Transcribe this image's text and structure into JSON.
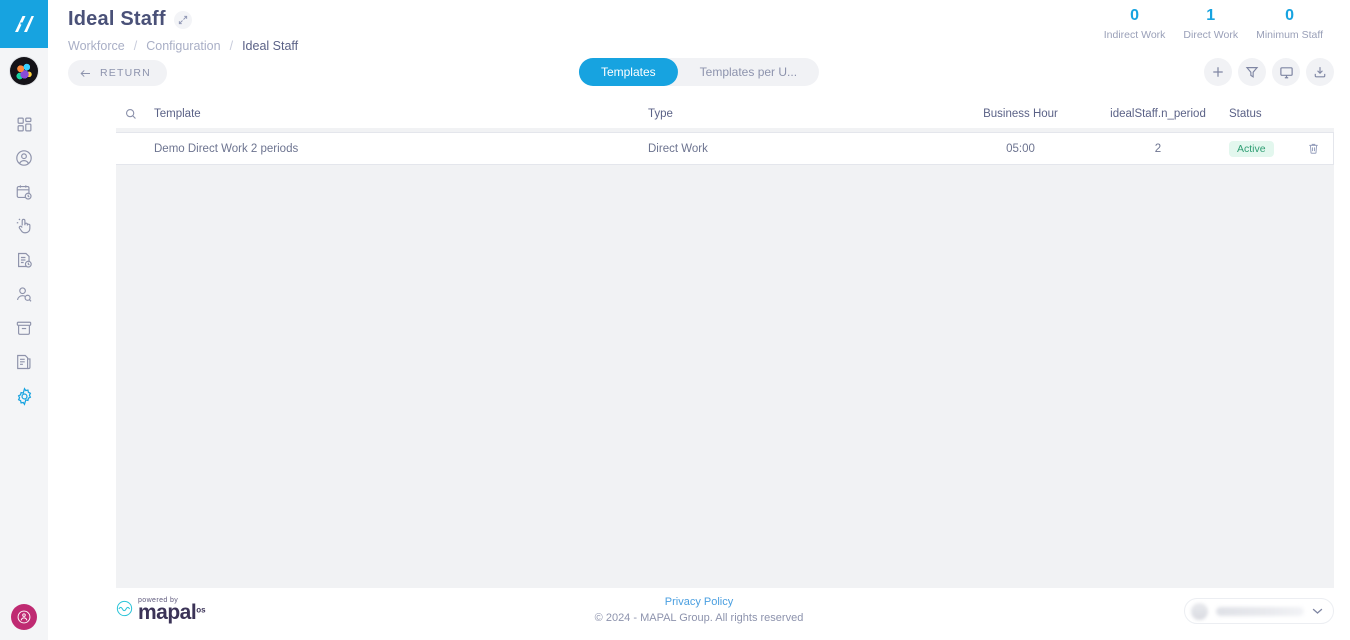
{
  "sidebar": {
    "brand_icon": "mapal-logo-icon",
    "avatar_name": "user-avatar",
    "items": [
      {
        "icon": "dashboard-grid-icon",
        "name": "sidebar-item-dashboard",
        "active": false
      },
      {
        "icon": "user-circle-icon",
        "name": "sidebar-item-profile",
        "active": false
      },
      {
        "icon": "calendar-clock-icon",
        "name": "sidebar-item-schedules",
        "active": false
      },
      {
        "icon": "hand-click-icon",
        "name": "sidebar-item-clocking",
        "active": false
      },
      {
        "icon": "document-clock-icon",
        "name": "sidebar-item-timesheets",
        "active": false
      },
      {
        "icon": "user-search-icon",
        "name": "sidebar-item-recruitment",
        "active": false
      },
      {
        "icon": "archive-box-icon",
        "name": "sidebar-item-archive",
        "active": false
      },
      {
        "icon": "documents-icon",
        "name": "sidebar-item-reports",
        "active": false
      },
      {
        "icon": "gear-icon",
        "name": "sidebar-item-configuration",
        "active": true
      }
    ],
    "bottom_badge": "help-badge-icon"
  },
  "header": {
    "title": "Ideal Staff",
    "edit_icon": "expand-edit-icon",
    "breadcrumb": [
      {
        "label": "Workforce",
        "current": false
      },
      {
        "label": "Configuration",
        "current": false
      },
      {
        "label": "Ideal Staff",
        "current": true
      }
    ],
    "breadcrumb_separator": "/"
  },
  "stats": [
    {
      "value": "0",
      "label": "Indirect Work"
    },
    {
      "value": "1",
      "label": "Direct Work"
    },
    {
      "value": "0",
      "label": "Minimum Staff"
    }
  ],
  "toolbar": {
    "return_label": "RETURN",
    "return_icon": "arrow-left-icon",
    "tabs": [
      {
        "label": "Templates",
        "active": true
      },
      {
        "label": "Templates per U...",
        "active": false
      }
    ],
    "icons": [
      {
        "name": "add-icon",
        "glyph": "plus"
      },
      {
        "name": "filter-icon",
        "glyph": "funnel"
      },
      {
        "name": "display-icon",
        "glyph": "monitor"
      },
      {
        "name": "download-icon",
        "glyph": "download"
      }
    ]
  },
  "table": {
    "search_icon": "search-icon",
    "columns": [
      "Template",
      "Type",
      "Business Hour",
      "idealStaff.n_period",
      "Status"
    ],
    "rows": [
      {
        "template": "Demo Direct Work 2 periods",
        "type": "Direct Work",
        "business_hour": "05:00",
        "n_period": "2",
        "status": "Active",
        "delete_icon": "trash-icon"
      }
    ]
  },
  "footer": {
    "logo_powered": "powered by",
    "logo_word": "mapal",
    "logo_suffix": "os",
    "privacy_label": "Privacy Policy",
    "copyright": "© 2024 - MAPAL Group. All rights reserved",
    "language_value": "",
    "language_chevron": "chevron-down-icon"
  },
  "colors": {
    "accent": "#17a3e0",
    "panel_bg": "#f1f2f4",
    "status_green_bg": "#e3f7ee",
    "status_green_fg": "#2f9e73",
    "sidebar_bg": "#f4f5f7",
    "badge_magenta": "#bf2a72"
  }
}
